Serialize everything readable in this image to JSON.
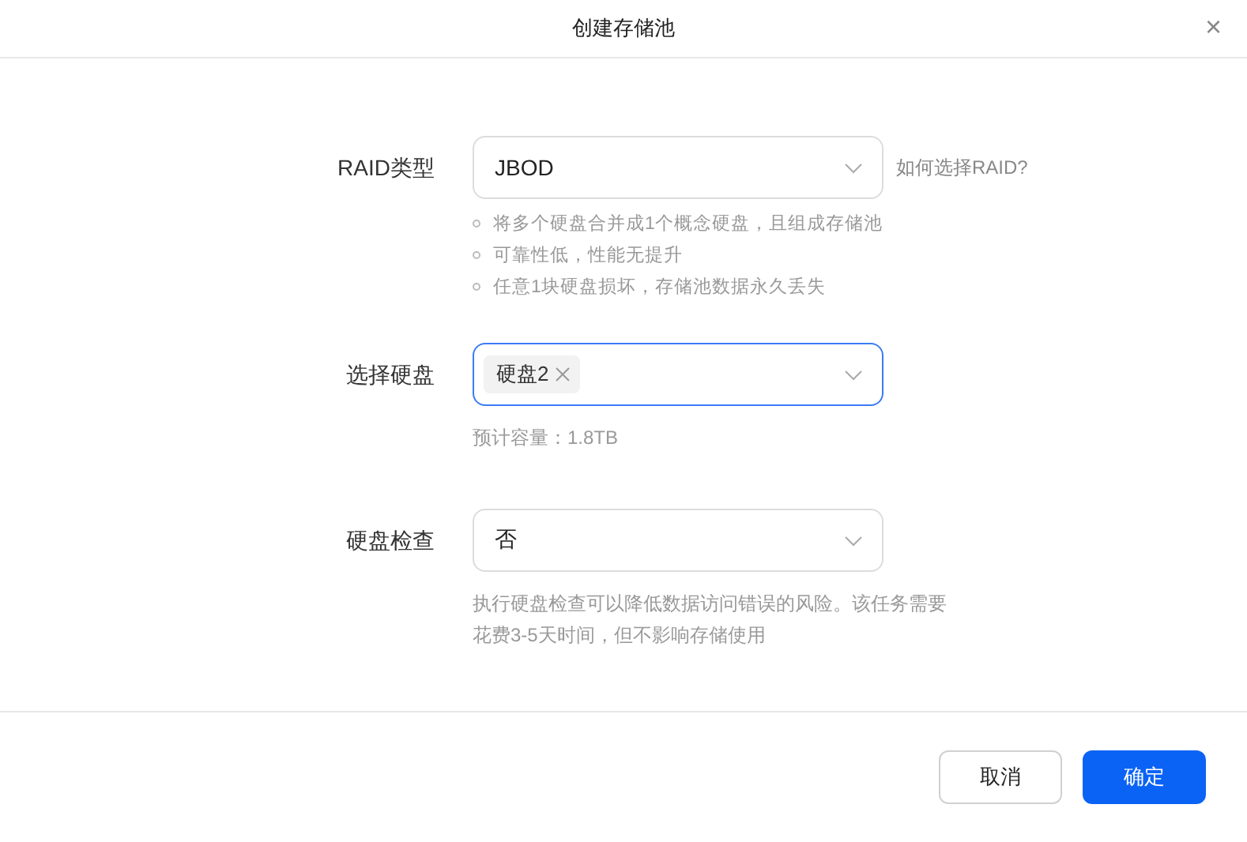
{
  "dialog": {
    "title": "创建存储池",
    "close": "×"
  },
  "fields": [
    {
      "kind": "select",
      "label": "RAID类型",
      "value": "JBOD",
      "focused": false,
      "link": "如何选择RAID?",
      "hints": [
        "将多个硬盘合并成1个概念硬盘，且组成存储池",
        "可靠性低，性能无提升",
        "任意1块硬盘损坏，存储池数据永久丢失"
      ]
    },
    {
      "kind": "tags",
      "label": "选择硬盘",
      "tags": [
        "硬盘2"
      ],
      "focused": true,
      "note": "预计容量：1.8TB"
    },
    {
      "kind": "select",
      "label": "硬盘检查",
      "value": "否",
      "focused": false,
      "note": "执行硬盘检查可以降低数据访问错误的风险。该任务需要花费3-5天时间，但不影响存储使用"
    }
  ],
  "buttons": [
    {
      "label": "取消",
      "kind": "secondary"
    },
    {
      "label": "确定",
      "kind": "primary"
    }
  ]
}
